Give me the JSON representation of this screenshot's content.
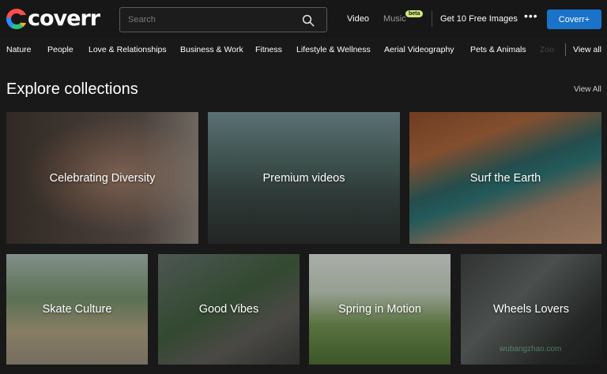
{
  "header": {
    "logo_text": "coverr",
    "search_placeholder": "Search",
    "nav": {
      "video": "Video",
      "music": "Music",
      "music_badge": "beta",
      "free_images": "Get 10 Free Images",
      "more": "•••",
      "cta": "Coverr+"
    }
  },
  "categories": {
    "items": [
      "Nature",
      "People",
      "Love & Relationships",
      "Business & Work",
      "Fitness",
      "Lifestyle & Wellness",
      "Aerial Videography",
      "Pets & Animals",
      "Zoo"
    ],
    "view_all": "View all"
  },
  "collections": {
    "title": "Explore collections",
    "view_all": "View All",
    "tiles": [
      {
        "label": "Celebrating Diversity"
      },
      {
        "label": "Premium videos"
      },
      {
        "label": "Surf the Earth"
      },
      {
        "label": "Skate Culture"
      },
      {
        "label": "Good Vibes"
      },
      {
        "label": "Spring in Motion"
      },
      {
        "label": "Wheels Lovers"
      }
    ]
  },
  "watermark": "wubangzhao.com",
  "colors": {
    "accent": "#1a73c8",
    "badge": "#cfe97a",
    "background": "#191919"
  }
}
